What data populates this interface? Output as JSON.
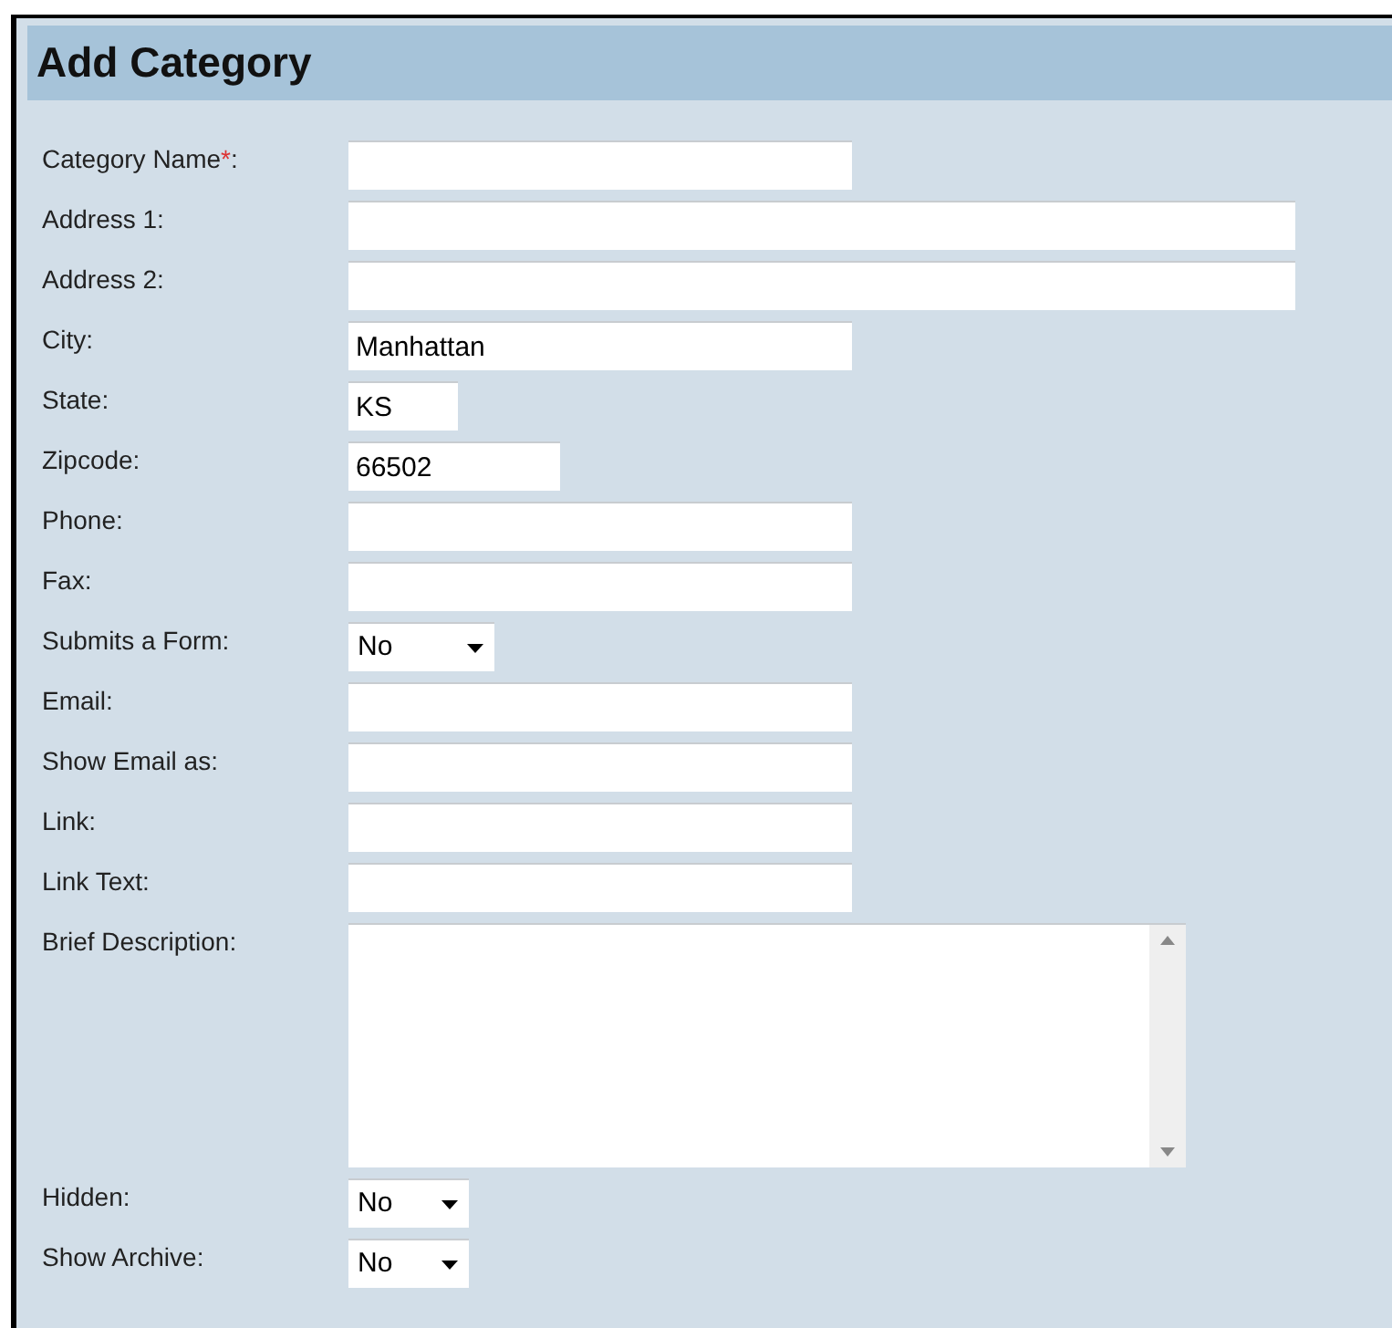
{
  "title": "Add Category",
  "fields": [
    {
      "label": "Category Name",
      "required_mark": "*",
      "label_end": ":",
      "kind": "text"
    },
    {
      "label": "Address 1:",
      "kind": "text"
    },
    {
      "label": "Address 2:",
      "kind": "text"
    },
    {
      "label": "City:",
      "kind": "text",
      "value": "Manhattan"
    },
    {
      "label": "State:",
      "kind": "text",
      "value": "KS"
    },
    {
      "label": "Zipcode:",
      "kind": "text",
      "value": "66502"
    },
    {
      "label": "Phone:",
      "kind": "text"
    },
    {
      "label": "Fax:",
      "kind": "text"
    },
    {
      "label": "Submits a Form:",
      "kind": "select",
      "value": "No"
    },
    {
      "label": "Email:",
      "kind": "text"
    },
    {
      "label": "Show Email as:",
      "kind": "text"
    },
    {
      "label": "Link:",
      "kind": "text"
    },
    {
      "label": "Link Text:",
      "kind": "text"
    },
    {
      "label": "Brief Description:",
      "kind": "textarea"
    },
    {
      "label": "Hidden:",
      "kind": "select",
      "value": "No"
    },
    {
      "label": "Show Archive:",
      "kind": "select",
      "value": "No"
    }
  ]
}
